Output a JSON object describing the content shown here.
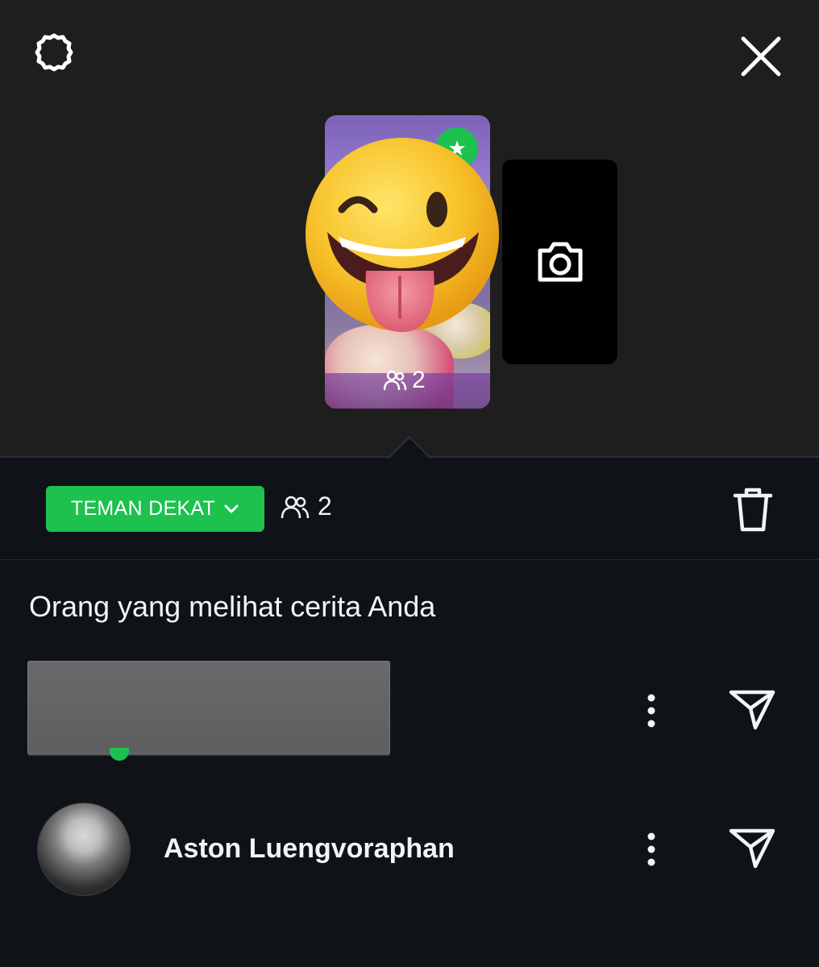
{
  "header": {
    "settings_icon": "gear-icon",
    "close_icon": "close-icon"
  },
  "story": {
    "viewer_count": "2",
    "badge_icon": "star-icon",
    "sticker": "winking-tongue-emoji",
    "camera_icon": "camera-icon"
  },
  "toolbar": {
    "audience_label": "TEMAN DEKAT",
    "viewer_count": "2",
    "delete_icon": "trash-icon"
  },
  "viewers": {
    "title": "Orang yang melihat cerita Anda",
    "list": [
      {
        "name": "",
        "redacted": true
      },
      {
        "name": "Aston Luengvoraphan",
        "redacted": false
      }
    ]
  },
  "colors": {
    "accent": "#1cc14e",
    "top_bg": "#1e1e1e",
    "bottom_bg": "#0f1317"
  }
}
